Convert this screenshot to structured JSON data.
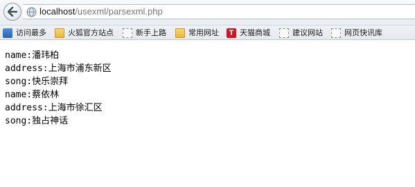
{
  "address_bar": {
    "host": "localhost",
    "path": "/usexml/parsexml.php"
  },
  "bookmarks": [
    {
      "label": "访问最多",
      "icon": "most-visited-icon"
    },
    {
      "label": "火狐官方站点",
      "icon": "folder-icon"
    },
    {
      "label": "新手上路",
      "icon": "page-icon"
    },
    {
      "label": "常用网址",
      "icon": "folder-icon"
    },
    {
      "label": "天猫商城",
      "icon": "tmall-icon",
      "icon_text": "T"
    },
    {
      "label": "建议网站",
      "icon": "page-icon"
    },
    {
      "label": "网页快讯库",
      "icon": "page-icon"
    }
  ],
  "content": {
    "lines": [
      "name:潘玮柏",
      "address:上海市浦东新区",
      "song:快乐崇拜",
      "name:蔡依林",
      "address:上海市徐汇区",
      "song:独占神话"
    ]
  }
}
